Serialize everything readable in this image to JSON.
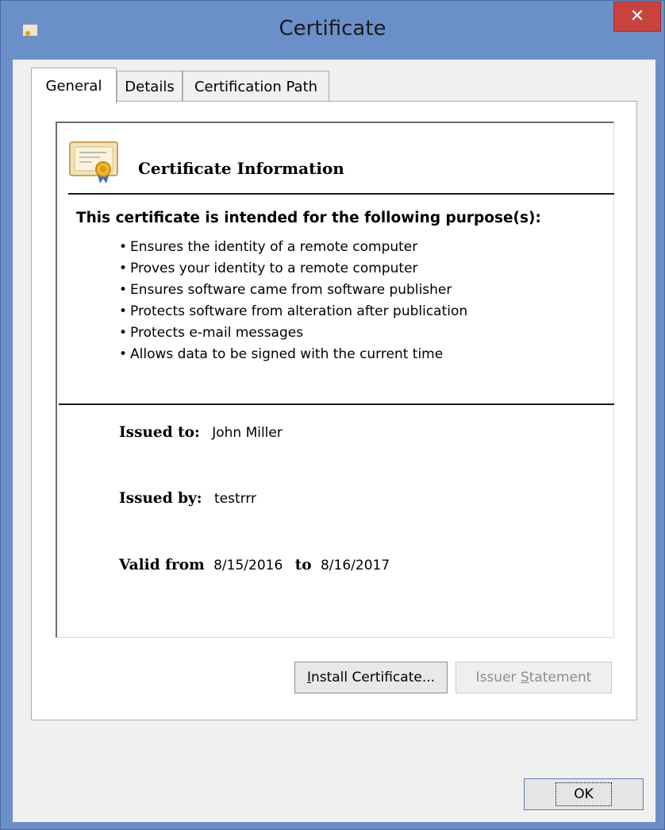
{
  "window": {
    "title": "Certificate",
    "close_glyph": "✕"
  },
  "tabs": [
    {
      "label": "General",
      "active": true
    },
    {
      "label": "Details",
      "active": false
    },
    {
      "label": "Certification Path",
      "active": false
    }
  ],
  "info": {
    "heading": "Certificate Information",
    "purpose_heading": "This certificate is intended for the following purpose(s):",
    "purposes": [
      "Ensures the identity of a remote computer",
      "Proves your identity to a remote computer",
      "Ensures software came from software publisher",
      "Protects software from alteration after publication",
      "Protects e-mail messages",
      "Allows data to be signed with the current time"
    ],
    "issued_to_label": "Issued to:",
    "issued_to": "John Miller",
    "issued_by_label": "Issued by:",
    "issued_by": "testrrr",
    "valid_from_label": "Valid from",
    "valid_from": "8/15/2016",
    "valid_to_label": "to",
    "valid_to": "8/16/2017"
  },
  "buttons": {
    "install_certificate_prefix": "",
    "install_certificate_accel": "I",
    "install_certificate_rest": "nstall Certificate...",
    "issuer_statement_prefix": "Issuer ",
    "issuer_statement_accel": "S",
    "issuer_statement_rest": "tatement",
    "ok": "OK"
  },
  "colors": {
    "title_bar": "#6b8fc9",
    "close_button": "#c8433b",
    "dialog_background": "#f0f0f0"
  },
  "icons": {
    "app": "certificate-icon",
    "info": "certificate-ribbon-icon",
    "close": "close-icon"
  }
}
